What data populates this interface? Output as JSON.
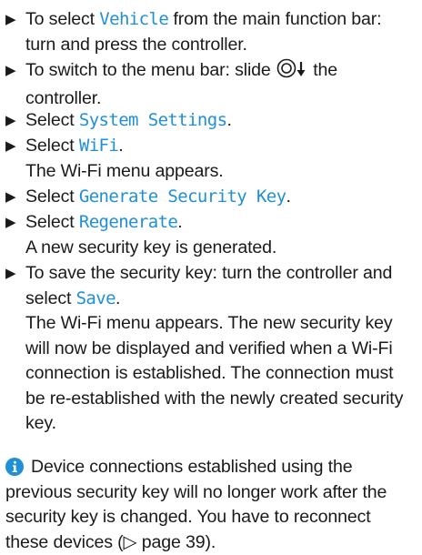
{
  "steps": [
    {
      "pre": "To select ",
      "kw": "Vehicle",
      "post": " from the main function bar: turn and press the controller."
    },
    {
      "pre": "To switch to the menu bar: slide ",
      "icon": "controller-slide-down-icon",
      "post": " the controller."
    },
    {
      "pre": "Select ",
      "kw": "System Settings",
      "post": "."
    },
    {
      "pre": "Select ",
      "kw": "WiFi",
      "post": ".",
      "result": "The Wi-Fi menu appears."
    },
    {
      "pre": "Select ",
      "kw": "Generate Security Key",
      "post": "."
    },
    {
      "pre": "Select ",
      "kw": "Regenerate",
      "post": ".",
      "result": "A new security key is generated."
    },
    {
      "pre": "To save the security key: turn the controller and select ",
      "kw": "Save",
      "post": ".",
      "result": "The Wi-Fi menu appears. The new security key will now be displayed and verified when a Wi-Fi connection is established. The connection must be re-established with the newly created security key."
    }
  ],
  "note": {
    "icon": "info-icon",
    "text": "Device connections established using the previous security key will no longer work after the security key is changed. You have to reconnect these devices (▷ page 39)."
  },
  "colors": {
    "keyword": "#1f8fd6",
    "text": "#1a1a1a",
    "info_icon": "#1f8fd6"
  }
}
